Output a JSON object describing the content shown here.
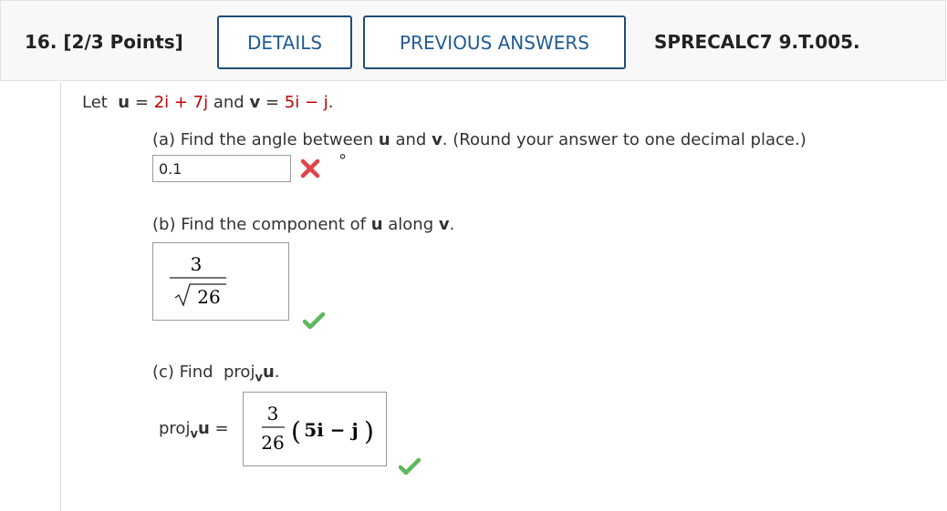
{
  "header": {
    "question_number": "16.",
    "points": "[2/3 Points]",
    "details_label": "DETAILS",
    "previous_answers_label": "PREVIOUS ANSWERS",
    "problem_code": "SPRECALC7 9.T.005."
  },
  "problem": {
    "let": "Let",
    "u": "u",
    "u_value": "2i + 7j",
    "and": "and",
    "v": "v",
    "v_value": "5i − j",
    "period": ".",
    "equals": "="
  },
  "part_a": {
    "prompt_start": "(a) Find the angle between",
    "u": "u",
    "and": "and",
    "v": "v",
    "prompt_end": ". (Round your answer to one decimal place.)",
    "answer_value": "0.1",
    "unit": "°",
    "status": "incorrect"
  },
  "part_b": {
    "prompt_start": "(b) Find the component of",
    "u": "u",
    "along": "along",
    "v": "v",
    "period": ".",
    "numerator": "3",
    "radicand": "26",
    "status": "correct"
  },
  "part_c": {
    "prompt_start": "(c) Find",
    "proj": "proj",
    "sub": "v",
    "u": "u",
    "period": ".",
    "label_proj": "proj",
    "label_sub": "v",
    "label_u": "u",
    "label_eq": "=",
    "numerator": "3",
    "denominator": "26",
    "expression": "5i − j",
    "status": "correct"
  },
  "colors": {
    "button_border": "#1f4e79",
    "button_text": "#1f5b96",
    "highlight_red": "#c00000",
    "check_green": "#5cb85c",
    "x_red": "#e0424b"
  }
}
